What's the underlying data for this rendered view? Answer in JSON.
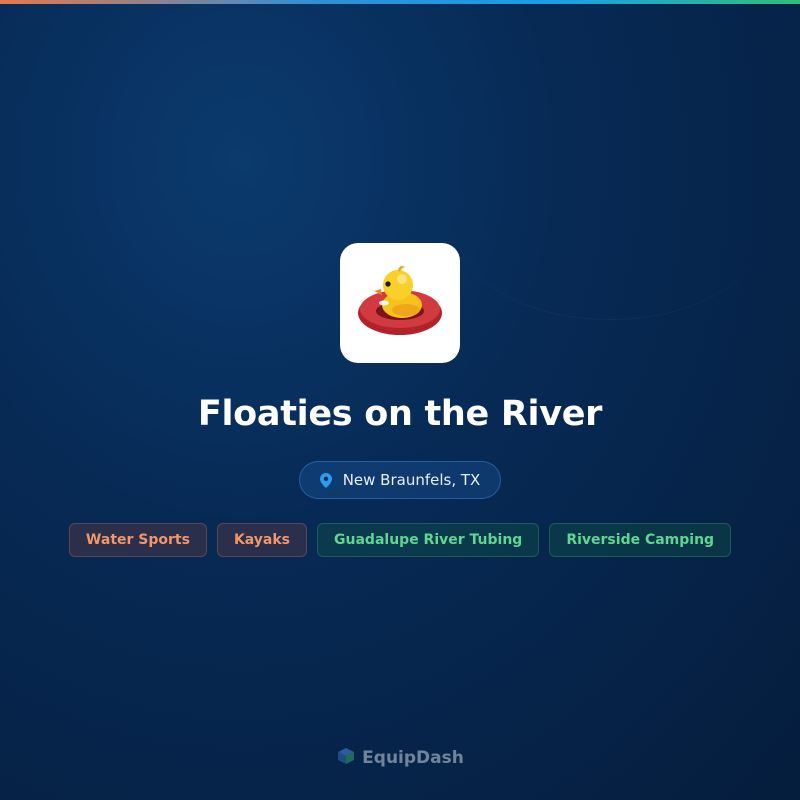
{
  "business": {
    "name": "Floaties on the River",
    "logo_icon": "duck-float-icon",
    "location": "New Braunfels, TX",
    "location_icon": "map-pin-icon"
  },
  "tags": [
    {
      "label": "Water Sports",
      "tone": "orange"
    },
    {
      "label": "Kayaks",
      "tone": "orange"
    },
    {
      "label": "Guadalupe River Tubing",
      "tone": "green"
    },
    {
      "label": "Riverside Camping",
      "tone": "green"
    }
  ],
  "brand": {
    "name": "EquipDash",
    "logo_icon": "equipdash-logo-icon"
  },
  "colors": {
    "background": "#072a55",
    "accent_blue": "#2f8fd8",
    "tag_orange": "#f2956a",
    "tag_green": "#5fd692"
  }
}
